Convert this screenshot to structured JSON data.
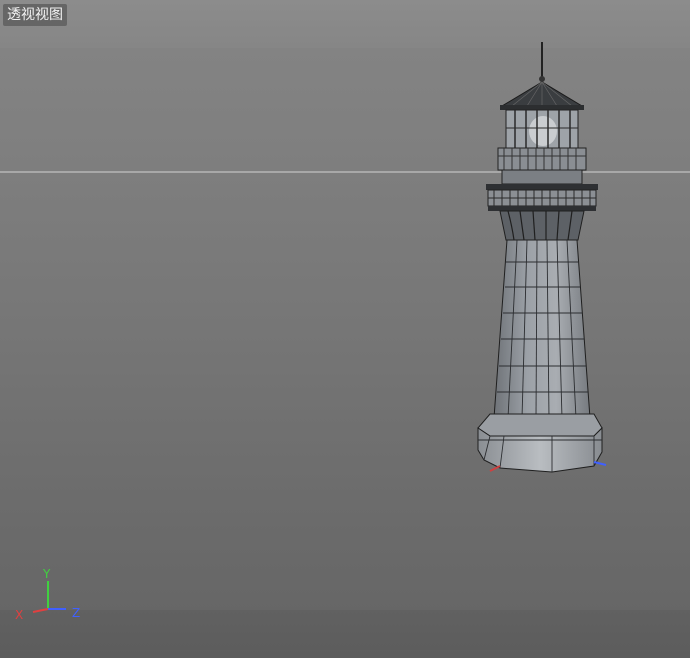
{
  "viewport": {
    "view_name": "透视视图"
  },
  "axis_gizmo": {
    "x_label": "X",
    "y_label": "Y",
    "z_label": "Z",
    "x_color": "#e04040",
    "y_color": "#40d040",
    "z_color": "#4060ff"
  },
  "scene": {
    "object": "lighthouse"
  }
}
